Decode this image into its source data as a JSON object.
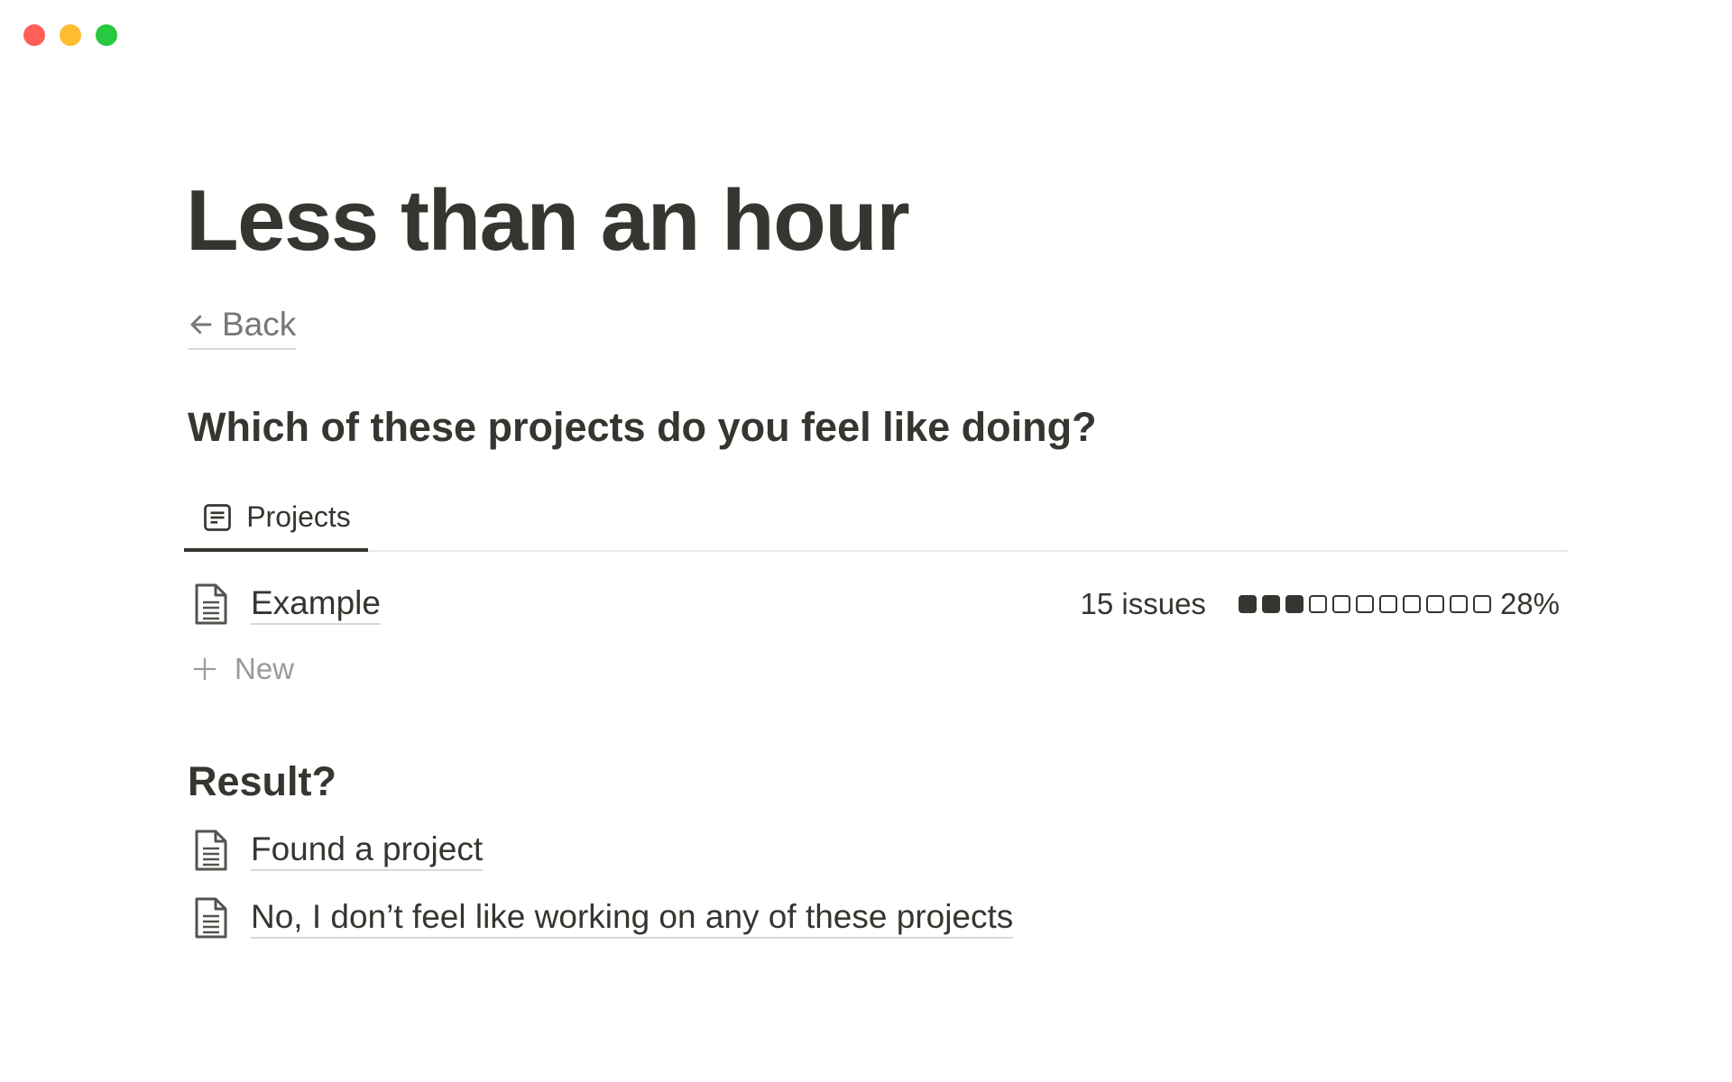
{
  "window": {
    "controls": [
      {
        "name": "close",
        "color": "#ff5f57"
      },
      {
        "name": "minimize",
        "color": "#febc2e"
      },
      {
        "name": "zoom",
        "color": "#28c840"
      }
    ]
  },
  "page": {
    "title": "Less than an hour",
    "back_label": "Back",
    "back_icon": "arrow-left-icon",
    "question": "Which of these projects do you feel like doing?"
  },
  "database": {
    "tab_icon": "table-view-icon",
    "tab_label": "Projects",
    "rows": [
      {
        "icon": "page-icon",
        "title": "Example",
        "issues": "15 issues",
        "progress_fraction": 0.28,
        "progress_filled": 3,
        "progress_total": 11,
        "progress_label": "28%"
      }
    ],
    "new_label": "New",
    "new_icon": "plus-icon"
  },
  "result": {
    "heading": "Result?",
    "links": [
      {
        "icon": "page-icon",
        "label": "Found a project"
      },
      {
        "icon": "page-icon",
        "label": "No, I don’t feel like working on any of these projects"
      }
    ]
  },
  "colors": {
    "text": "#37352f",
    "muted": "#787774",
    "placeholder": "#9b9a97",
    "divider": "#e9e9e7"
  }
}
